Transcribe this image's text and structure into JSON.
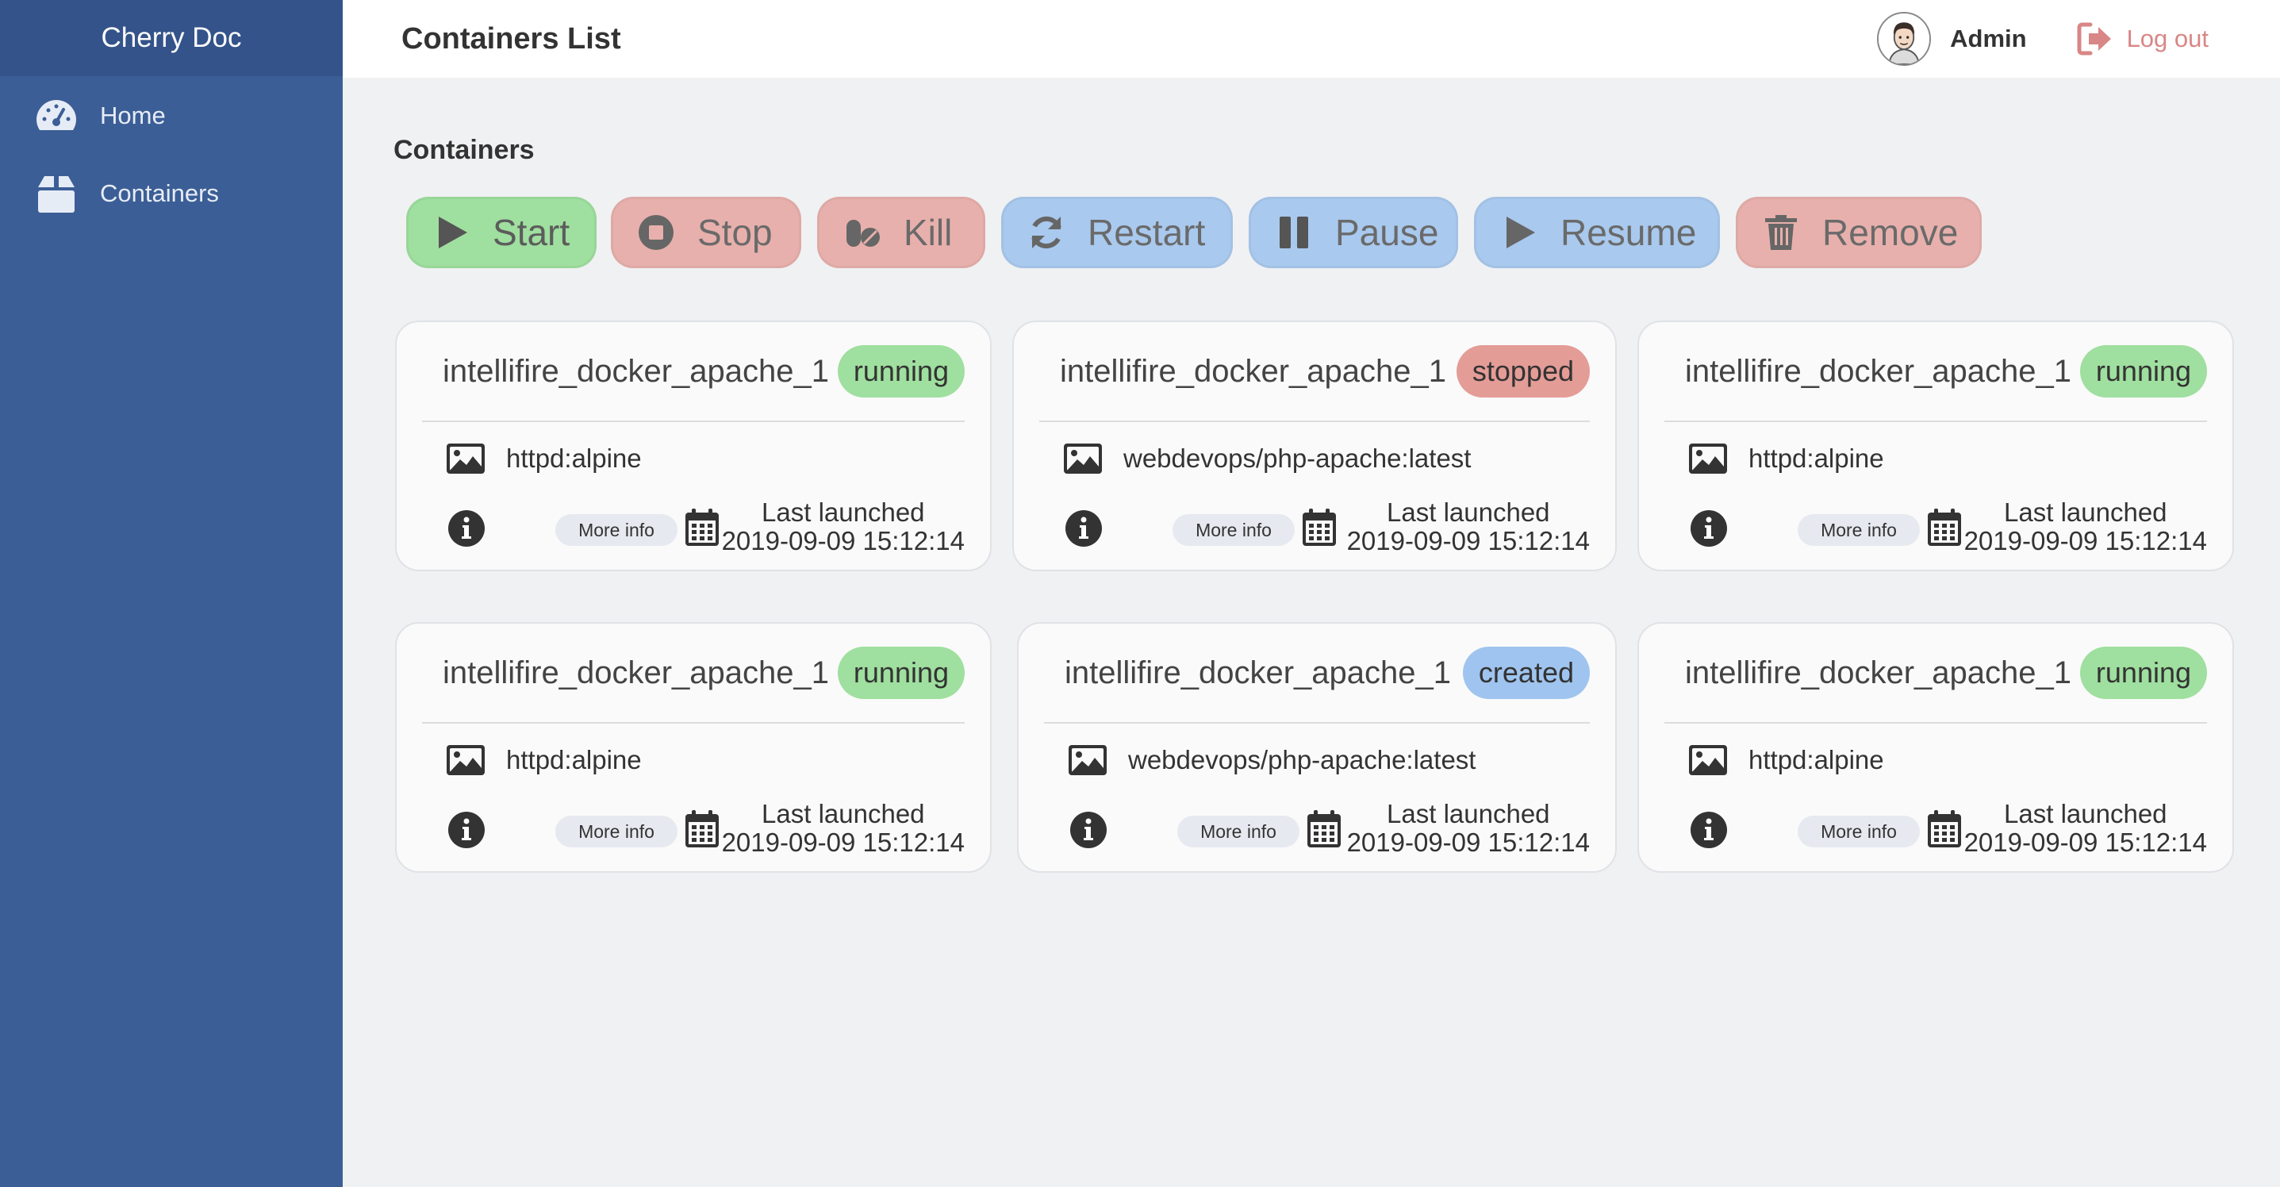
{
  "sidebar": {
    "brand": "Cherry Doc",
    "items": [
      {
        "label": "Home",
        "icon": "dashboard-icon"
      },
      {
        "label": "Containers",
        "icon": "box-icon"
      }
    ]
  },
  "header": {
    "title": "Containers List",
    "user_name": "Admin",
    "logout_label": "Log out"
  },
  "main": {
    "section_title": "Containers",
    "actions": [
      {
        "label": "Start",
        "icon": "play-icon",
        "color": "#9fdf9f"
      },
      {
        "label": "Stop",
        "icon": "stop-circle-icon",
        "color": "#e8b0ac"
      },
      {
        "label": "Kill",
        "icon": "pills-icon",
        "color": "#e8b0ac"
      },
      {
        "label": "Restart",
        "icon": "refresh-icon",
        "color": "#a9c9ee"
      },
      {
        "label": "Pause",
        "icon": "pause-icon",
        "color": "#a9c9ee"
      },
      {
        "label": "Resume",
        "icon": "play-icon",
        "color": "#a9c9ee"
      },
      {
        "label": "Remove",
        "icon": "trash-icon",
        "color": "#e8b0ac"
      }
    ],
    "containers": [
      {
        "name": "intellifire_docker_apache_1",
        "status": "running",
        "image": "httpd:alpine",
        "more_info": "More info",
        "last_launched_label": "Last launched",
        "last_launched": "2019-09-09 15:12:14"
      },
      {
        "name": "intellifire_docker_apache_1",
        "status": "stopped",
        "image": "webdevops/php-apache:latest",
        "more_info": "More info",
        "last_launched_label": "Last launched",
        "last_launched": "2019-09-09 15:12:14"
      },
      {
        "name": "intellifire_docker_apache_1",
        "status": "running",
        "image": "httpd:alpine",
        "more_info": "More info",
        "last_launched_label": "Last launched",
        "last_launched": "2019-09-09 15:12:14"
      },
      {
        "name": "intellifire_docker_apache_1",
        "status": "running",
        "image": "httpd:alpine",
        "more_info": "More info",
        "last_launched_label": "Last launched",
        "last_launched": "2019-09-09 15:12:14"
      },
      {
        "name": "intellifire_docker_apache_1",
        "status": "created",
        "image": "webdevops/php-apache:latest",
        "more_info": "More info",
        "last_launched_label": "Last launched",
        "last_launched": "2019-09-09 15:12:14"
      },
      {
        "name": "intellifire_docker_apache_1",
        "status": "running",
        "image": "httpd:alpine",
        "more_info": "More info",
        "last_launched_label": "Last launched",
        "last_launched": "2019-09-09 15:12:14"
      }
    ]
  },
  "colors": {
    "sidebar": "#3c5e96",
    "brand_bar": "#34538a",
    "running": "#9fdf9f",
    "stopped": "#e49c96",
    "created": "#9fc4ef",
    "logout": "#d98686"
  }
}
